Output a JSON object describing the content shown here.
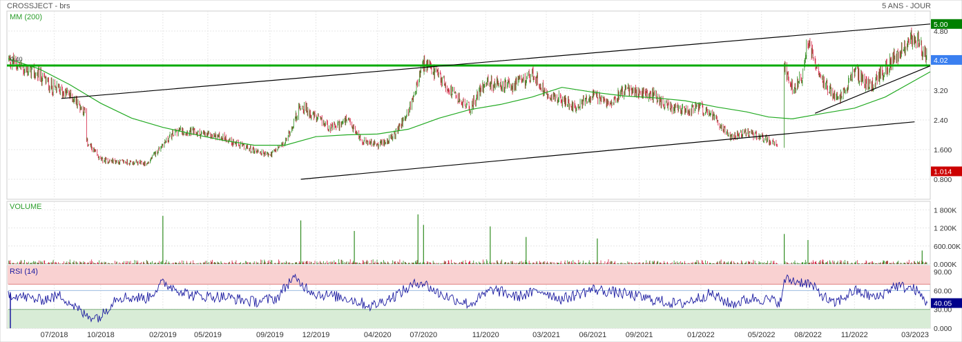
{
  "header": {
    "title": "CROSSJECT - brs",
    "period": "5 ANS - JOUR"
  },
  "chart_data": {
    "type": "candlestick",
    "panels": {
      "price": {
        "label": "MM (200)",
        "y_ticks": [
          "4.80",
          "4.02",
          "3.20",
          "2.40",
          "1.600",
          "0.800"
        ],
        "ylim": [
          0.78,
          5.0
        ],
        "markers": [
          {
            "label": "5.00",
            "value": 4.99,
            "color": "#008000"
          },
          {
            "label": "4.02",
            "value": 4.02,
            "color": "#3a7ff0"
          },
          {
            "label": "1.014",
            "value": 1.014,
            "color": "#cc0000"
          }
        ],
        "left_label": "0.40",
        "horizontal_level": 3.87,
        "trendlines": [
          {
            "from": [
              "2018-07-15",
              2.98
            ],
            "to": [
              "2023-03-31",
              4.99
            ]
          },
          {
            "from": [
              "2019-11-01",
              0.8
            ],
            "to": [
              "2023-02-28",
              2.35
            ]
          },
          {
            "from": [
              "2022-08-15",
              2.58
            ],
            "to": [
              "2023-03-31",
              3.86
            ]
          }
        ],
        "close_path": [
          [
            "2018-04-01",
            4.05
          ],
          [
            "2018-05-01",
            3.78
          ],
          [
            "2018-06-01",
            3.6
          ],
          [
            "2018-07-01",
            3.25
          ],
          [
            "2018-08-01",
            3.08
          ],
          [
            "2018-08-31",
            2.62
          ],
          [
            "2018-09-01",
            1.85
          ],
          [
            "2018-10-01",
            1.32
          ],
          [
            "2018-11-01",
            1.28
          ],
          [
            "2018-12-01",
            1.25
          ],
          [
            "2019-01-01",
            1.22
          ],
          [
            "2019-02-01",
            1.75
          ],
          [
            "2019-03-01",
            2.12
          ],
          [
            "2019-04-01",
            2.08
          ],
          [
            "2019-05-01",
            1.98
          ],
          [
            "2019-06-01",
            1.94
          ],
          [
            "2019-07-01",
            1.72
          ],
          [
            "2019-08-01",
            1.58
          ],
          [
            "2019-09-01",
            1.45
          ],
          [
            "2019-10-01",
            1.78
          ],
          [
            "2019-11-01",
            2.8
          ],
          [
            "2019-12-01",
            2.45
          ],
          [
            "2020-01-01",
            2.18
          ],
          [
            "2020-02-01",
            2.38
          ],
          [
            "2020-03-01",
            1.85
          ],
          [
            "2020-04-01",
            1.72
          ],
          [
            "2020-05-01",
            1.92
          ],
          [
            "2020-06-01",
            2.62
          ],
          [
            "2020-07-01",
            3.9
          ],
          [
            "2020-08-01",
            3.55
          ],
          [
            "2020-09-01",
            3.05
          ],
          [
            "2020-10-01",
            2.7
          ],
          [
            "2020-11-01",
            3.45
          ],
          [
            "2020-12-01",
            3.3
          ],
          [
            "2021-01-01",
            3.35
          ],
          [
            "2021-02-01",
            3.62
          ],
          [
            "2021-03-01",
            3.15
          ],
          [
            "2021-04-01",
            2.92
          ],
          [
            "2021-05-01",
            2.75
          ],
          [
            "2021-06-01",
            3.05
          ],
          [
            "2021-07-01",
            2.85
          ],
          [
            "2021-08-01",
            3.22
          ],
          [
            "2021-09-01",
            3.12
          ],
          [
            "2021-10-01",
            3.05
          ],
          [
            "2021-11-01",
            2.72
          ],
          [
            "2021-12-01",
            2.62
          ],
          [
            "2022-01-01",
            2.72
          ],
          [
            "2022-02-01",
            2.4
          ],
          [
            "2022-03-01",
            1.95
          ],
          [
            "2022-04-01",
            2.05
          ],
          [
            "2022-05-01",
            1.95
          ],
          [
            "2022-06-01",
            1.72
          ],
          [
            "2022-06-15",
            3.85
          ],
          [
            "2022-07-01",
            3.22
          ],
          [
            "2022-07-20",
            3.55
          ],
          [
            "2022-08-01",
            4.55
          ],
          [
            "2022-09-01",
            3.4
          ],
          [
            "2022-10-01",
            2.9
          ],
          [
            "2022-11-01",
            3.72
          ],
          [
            "2022-12-01",
            3.3
          ],
          [
            "2023-01-01",
            3.75
          ],
          [
            "2023-02-01",
            4.3
          ],
          [
            "2023-03-01",
            4.7
          ],
          [
            "2023-03-25",
            4.02
          ]
        ],
        "gaps": [
          [
            "2018-08-31",
            "2018-09-01"
          ],
          [
            "2022-06-01",
            "2022-06-15"
          ]
        ],
        "ma_path": [
          [
            "2018-04-01",
            4.05
          ],
          [
            "2018-06-01",
            3.78
          ],
          [
            "2018-08-01",
            3.35
          ],
          [
            "2018-10-01",
            2.85
          ],
          [
            "2018-12-01",
            2.45
          ],
          [
            "2019-02-01",
            2.2
          ],
          [
            "2019-04-01",
            2.02
          ],
          [
            "2019-06-01",
            1.85
          ],
          [
            "2019-08-01",
            1.72
          ],
          [
            "2019-10-01",
            1.72
          ],
          [
            "2019-12-01",
            1.95
          ],
          [
            "2020-02-01",
            2.0
          ],
          [
            "2020-04-01",
            2.02
          ],
          [
            "2020-06-01",
            2.15
          ],
          [
            "2020-08-01",
            2.45
          ],
          [
            "2020-10-01",
            2.68
          ],
          [
            "2020-12-01",
            2.82
          ],
          [
            "2021-02-01",
            3.02
          ],
          [
            "2021-04-01",
            3.28
          ],
          [
            "2021-06-01",
            3.15
          ],
          [
            "2021-08-01",
            3.05
          ],
          [
            "2021-10-01",
            3.0
          ],
          [
            "2021-12-01",
            2.92
          ],
          [
            "2022-02-01",
            2.75
          ],
          [
            "2022-04-01",
            2.62
          ],
          [
            "2022-05-15",
            2.48
          ],
          [
            "2022-07-01",
            2.43
          ],
          [
            "2022-09-01",
            2.58
          ],
          [
            "2022-11-01",
            2.72
          ],
          [
            "2023-01-01",
            3.02
          ],
          [
            "2023-03-31",
            3.7
          ]
        ]
      },
      "volume": {
        "label": "VOLUME",
        "y_ticks": [
          "1 800K",
          "1 200K",
          "600.00K",
          "0.000K"
        ],
        "ylim": [
          0,
          1900
        ],
        "spikes": [
          [
            "2019-02-01",
            1600
          ],
          [
            "2019-11-01",
            1450
          ],
          [
            "2020-02-15",
            1100
          ],
          [
            "2020-06-20",
            1650
          ],
          [
            "2020-07-01",
            1300
          ],
          [
            "2020-11-10",
            1250
          ],
          [
            "2021-01-20",
            900
          ],
          [
            "2021-06-10",
            850
          ],
          [
            "2022-06-15",
            1000
          ],
          [
            "2022-08-01",
            800
          ],
          [
            "2023-03-15",
            450
          ]
        ]
      },
      "rsi": {
        "label": "RSI (14)",
        "y_ticks": [
          "90.00",
          "60.00",
          "30.00",
          "0.000"
        ],
        "ylim": [
          0,
          100
        ],
        "bands": [
          {
            "from": 70,
            "to": 100,
            "color": "#f9d1d1"
          },
          {
            "from": 0,
            "to": 30,
            "color": "#d8ecd6"
          }
        ],
        "marker": {
          "label": "40.05",
          "value": 40.05,
          "color": "#00008b"
        },
        "path": [
          [
            "2018-04-01",
            55
          ],
          [
            "2018-06-01",
            45
          ],
          [
            "2018-07-15",
            52
          ],
          [
            "2018-09-01",
            20
          ],
          [
            "2018-10-01",
            18
          ],
          [
            "2018-11-01",
            50
          ],
          [
            "2019-01-01",
            48
          ],
          [
            "2019-02-01",
            72
          ],
          [
            "2019-04-01",
            52
          ],
          [
            "2019-06-01",
            50
          ],
          [
            "2019-08-01",
            42
          ],
          [
            "2019-09-15",
            48
          ],
          [
            "2019-10-15",
            80
          ],
          [
            "2019-12-01",
            55
          ],
          [
            "2020-02-01",
            48
          ],
          [
            "2020-03-20",
            35
          ],
          [
            "2020-05-01",
            50
          ],
          [
            "2020-06-25",
            75
          ],
          [
            "2020-08-01",
            55
          ],
          [
            "2020-10-01",
            38
          ],
          [
            "2020-11-15",
            62
          ],
          [
            "2021-01-01",
            50
          ],
          [
            "2021-02-20",
            60
          ],
          [
            "2021-04-01",
            46
          ],
          [
            "2021-06-01",
            62
          ],
          [
            "2021-08-01",
            55
          ],
          [
            "2021-10-01",
            45
          ],
          [
            "2021-11-20",
            38
          ],
          [
            "2022-01-20",
            55
          ],
          [
            "2022-03-01",
            38
          ],
          [
            "2022-04-15",
            48
          ],
          [
            "2022-06-10",
            42
          ],
          [
            "2022-06-15",
            78
          ],
          [
            "2022-08-01",
            72
          ],
          [
            "2022-09-20",
            38
          ],
          [
            "2022-11-01",
            60
          ],
          [
            "2022-12-15",
            48
          ],
          [
            "2023-01-20",
            68
          ],
          [
            "2023-03-01",
            62
          ],
          [
            "2023-03-25",
            40.05
          ]
        ]
      }
    },
    "x_ticks": [
      "07/2018",
      "10/2018",
      "02/2019",
      "05/2019",
      "09/2019",
      "12/2019",
      "04/2020",
      "07/2020",
      "11/2020",
      "03/2021",
      "06/2021",
      "09/2021",
      "01/2022",
      "05/2022",
      "08/2022",
      "11/2022",
      "03/2023"
    ],
    "colors": {
      "up": "#2e8b1e",
      "down": "#d42040",
      "ma": "#22aa22",
      "level": "#00aa00",
      "trend": "#000000",
      "rsi": "#1a1aa0"
    }
  }
}
